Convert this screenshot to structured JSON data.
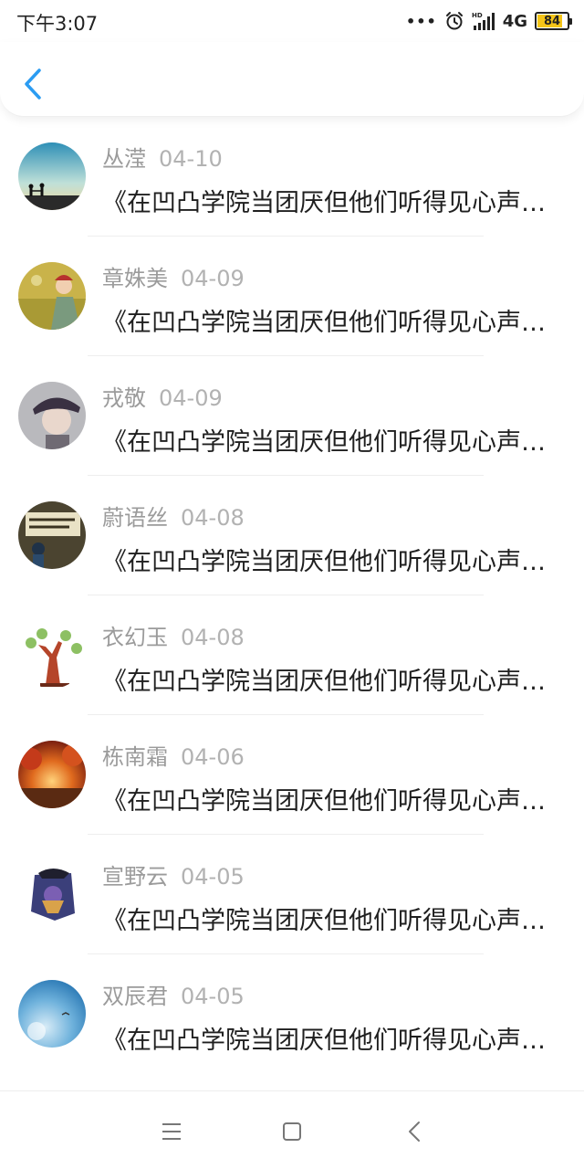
{
  "status_bar": {
    "time": "下午3:07",
    "dots": "•••",
    "network": "4G",
    "battery_level": "84",
    "icons": [
      "alarm-icon",
      "signal-icon"
    ],
    "battery_color": "#f5c518"
  },
  "header": {
    "back_icon": "chevron-left-icon",
    "accent_color": "#2b9cf2"
  },
  "messages": [
    {
      "name": "丛滢",
      "date": "04-10",
      "text": "《在凹凸学院当团厌但他们听得见心声》更新"
    },
    {
      "name": "章姝美",
      "date": "04-09",
      "text": "《在凹凸学院当团厌但他们听得见心声》更新"
    },
    {
      "name": "戎敬",
      "date": "04-09",
      "text": "《在凹凸学院当团厌但他们听得见心声》更新"
    },
    {
      "name": "蔚语丝",
      "date": "04-08",
      "text": "《在凹凸学院当团厌但他们听得见心声》更新"
    },
    {
      "name": "衣幻玉",
      "date": "04-08",
      "text": "《在凹凸学院当团厌但他们听得见心声》更新"
    },
    {
      "name": "栋南霜",
      "date": "04-06",
      "text": "《在凹凸学院当团厌但他们听得见心声》更新"
    },
    {
      "name": "宣野云",
      "date": "04-05",
      "text": "《在凹凸学院当团厌但他们听得见心声》更新"
    },
    {
      "name": "双辰君",
      "date": "04-05",
      "text": "《在凹凸学院当团厌但他们听得见心声》更新"
    }
  ],
  "nav_bar": {
    "icons": [
      "menu-icon",
      "home-square-icon",
      "back-triangle-icon"
    ]
  }
}
